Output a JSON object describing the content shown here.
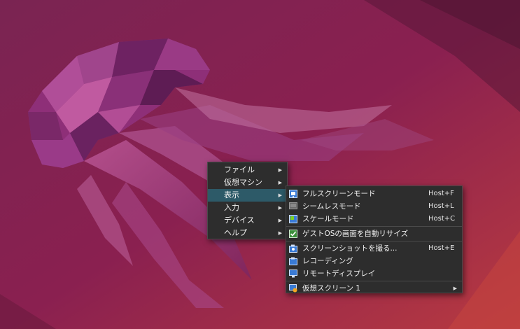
{
  "main_menu": {
    "items": [
      {
        "label": "ファイル",
        "has_submenu": true
      },
      {
        "label": "仮想マシン",
        "has_submenu": true
      },
      {
        "label": "表示",
        "has_submenu": true,
        "active": true
      },
      {
        "label": "入力",
        "has_submenu": true
      },
      {
        "label": "デバイス",
        "has_submenu": true
      },
      {
        "label": "ヘルプ",
        "has_submenu": true
      }
    ]
  },
  "view_menu": {
    "items": [
      {
        "label": "フルスクリーンモード",
        "shortcut": "Host+F",
        "icon": "fullscreen-icon"
      },
      {
        "label": "シームレスモード",
        "shortcut": "Host+L",
        "icon": "seamless-icon"
      },
      {
        "label": "スケールモード",
        "shortcut": "Host+C",
        "icon": "scale-icon"
      },
      {
        "label": "ゲストOSの画面を自動リサイズ",
        "shortcut": "",
        "icon": "auto-resize-checkbox-icon",
        "checked": true
      },
      {
        "label": "スクリーンショットを撮る...",
        "shortcut": "Host+E",
        "icon": "screenshot-icon"
      },
      {
        "label": "レコーディング",
        "shortcut": "",
        "icon": "recording-icon"
      },
      {
        "label": "リモートディスプレイ",
        "shortcut": "",
        "icon": "remote-display-icon"
      },
      {
        "label": "仮想スクリーン 1",
        "shortcut": "",
        "icon": "virtual-screen-icon",
        "has_submenu": true
      }
    ]
  },
  "colors": {
    "menu_bg": "#2d2d2d",
    "highlight": "#2d5a68",
    "wallpaper_base": "#7a1f4a"
  }
}
